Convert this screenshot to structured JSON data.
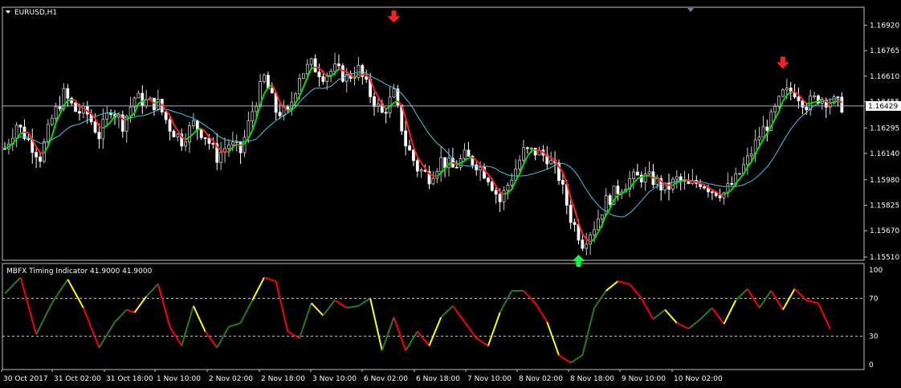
{
  "window": {
    "symbol_label": "EURUSD,H1"
  },
  "colors": {
    "background": "#000000",
    "frame": "#c0c0c0",
    "bull_candle": "#c8c8c8",
    "bear_candle": "#ffffff",
    "fast_up": "#00e000",
    "fast_down": "#ff2020",
    "slow_ma": "#40c8e0",
    "signal_down_arrow": "#ff2020",
    "signal_up_arrow": "#00ff40",
    "osc_red": "#ff0000",
    "osc_green": "#208020",
    "osc_yellow": "#ffff00",
    "level_line": "#c8c8c8",
    "text": "#ffffff"
  },
  "chart_data": [
    {
      "type": "line",
      "subtype": "candlestick",
      "title": "EURUSD,H1",
      "ylim": [
        1.1551,
        1.17
      ],
      "y_ticks": [
        "1.16920",
        "1.16765",
        "1.16610",
        "1.16455",
        "1.16295",
        "1.16140",
        "1.15980",
        "1.15825",
        "1.15670",
        "1.15510"
      ],
      "current_price": "1.16429",
      "x_ticks": [
        "30 Oct 2017",
        "31 Oct 02:00",
        "31 Oct 18:00",
        "1 Nov 10:00",
        "2 Nov 02:00",
        "2 Nov 18:00",
        "3 Nov 10:00",
        "6 Nov 02:00",
        "6 Nov 18:00",
        "7 Nov 10:00",
        "8 Nov 02:00",
        "8 Nov 18:00",
        "9 Nov 10:00",
        "10 Nov 02:00"
      ],
      "price_path": [
        [
          0,
          1.1617
        ],
        [
          3,
          1.1632
        ],
        [
          6,
          1.1622
        ],
        [
          9,
          1.1612
        ],
        [
          12,
          1.1635
        ],
        [
          15,
          1.165
        ],
        [
          18,
          1.164
        ],
        [
          21,
          1.1638
        ],
        [
          24,
          1.1625
        ],
        [
          27,
          1.1642
        ],
        [
          30,
          1.1632
        ],
        [
          33,
          1.1648
        ],
        [
          36,
          1.1645
        ],
        [
          39,
          1.1644
        ],
        [
          42,
          1.163
        ],
        [
          45,
          1.1622
        ],
        [
          48,
          1.1632
        ],
        [
          51,
          1.1625
        ],
        [
          54,
          1.1612
        ],
        [
          57,
          1.162
        ],
        [
          60,
          1.1615
        ],
        [
          63,
          1.164
        ],
        [
          66,
          1.166
        ],
        [
          69,
          1.164
        ],
        [
          72,
          1.1638
        ],
        [
          75,
          1.1662
        ],
        [
          78,
          1.1668
        ],
        [
          81,
          1.1662
        ],
        [
          84,
          1.1665
        ],
        [
          87,
          1.166
        ],
        [
          90,
          1.1665
        ],
        [
          93,
          1.165
        ],
        [
          96,
          1.1638
        ],
        [
          99,
          1.165
        ],
        [
          102,
          1.162
        ],
        [
          105,
          1.1605
        ],
        [
          108,
          1.16
        ],
        [
          111,
          1.161
        ],
        [
          114,
          1.1605
        ],
        [
          117,
          1.1612
        ],
        [
          120,
          1.1608
        ],
        [
          123,
          1.16
        ],
        [
          126,
          1.1585
        ],
        [
          129,
          1.16
        ],
        [
          132,
          1.1615
        ],
        [
          135,
          1.1615
        ],
        [
          138,
          1.1612
        ],
        [
          141,
          1.16
        ],
        [
          144,
          1.1575
        ],
        [
          147,
          1.156
        ],
        [
          150,
          1.157
        ],
        [
          153,
          1.1585
        ],
        [
          156,
          1.1592
        ],
        [
          159,
          1.1598
        ],
        [
          162,
          1.16
        ],
        [
          165,
          1.1598
        ],
        [
          168,
          1.1592
        ],
        [
          171,
          1.1598
        ],
        [
          174,
          1.1594
        ],
        [
          177,
          1.1597
        ],
        [
          180,
          1.1592
        ],
        [
          183,
          1.159
        ],
        [
          186,
          1.1598
        ],
        [
          189,
          1.161
        ],
        [
          192,
          1.1625
        ],
        [
          195,
          1.1635
        ],
        [
          198,
          1.165
        ],
        [
          201,
          1.1652
        ],
        [
          204,
          1.1644
        ],
        [
          207,
          1.1648
        ],
        [
          210,
          1.1646
        ],
        [
          213,
          1.1643
        ]
      ],
      "signals": [
        {
          "direction": "down",
          "bar": 99,
          "price": 1.1695
        },
        {
          "direction": "up",
          "bar": 146,
          "price": 1.1551
        },
        {
          "direction": "down",
          "bar": 198,
          "price": 1.1667
        }
      ]
    },
    {
      "type": "line",
      "title": "MBFX Timing Indicator 41.9000 41.9000",
      "ylim": [
        0,
        100
      ],
      "y_ticks": [
        "100",
        "70",
        "30",
        "0"
      ],
      "levels": [
        70,
        30
      ],
      "values": [
        [
          0,
          75
        ],
        [
          4,
          92
        ],
        [
          8,
          32
        ],
        [
          12,
          65
        ],
        [
          16,
          90
        ],
        [
          20,
          60
        ],
        [
          24,
          18
        ],
        [
          28,
          45
        ],
        [
          31,
          58
        ],
        [
          33,
          55
        ],
        [
          36,
          72
        ],
        [
          39,
          85
        ],
        [
          42,
          40
        ],
        [
          45,
          20
        ],
        [
          48,
          62
        ],
        [
          51,
          35
        ],
        [
          54,
          18
        ],
        [
          57,
          40
        ],
        [
          60,
          44
        ],
        [
          63,
          68
        ],
        [
          66,
          92
        ],
        [
          69,
          88
        ],
        [
          72,
          35
        ],
        [
          75,
          28
        ],
        [
          78,
          65
        ],
        [
          81,
          52
        ],
        [
          84,
          68
        ],
        [
          87,
          60
        ],
        [
          90,
          62
        ],
        [
          93,
          70
        ],
        [
          96,
          15
        ],
        [
          99,
          50
        ],
        [
          102,
          15
        ],
        [
          105,
          35
        ],
        [
          108,
          20
        ],
        [
          111,
          50
        ],
        [
          114,
          62
        ],
        [
          117,
          45
        ],
        [
          120,
          28
        ],
        [
          123,
          20
        ],
        [
          126,
          55
        ],
        [
          129,
          78
        ],
        [
          132,
          78
        ],
        [
          135,
          65
        ],
        [
          138,
          45
        ],
        [
          141,
          10
        ],
        [
          144,
          2
        ],
        [
          147,
          10
        ],
        [
          150,
          60
        ],
        [
          153,
          78
        ],
        [
          156,
          88
        ],
        [
          159,
          85
        ],
        [
          162,
          70
        ],
        [
          165,
          48
        ],
        [
          168,
          58
        ],
        [
          171,
          44
        ],
        [
          174,
          38
        ],
        [
          177,
          48
        ],
        [
          180,
          60
        ],
        [
          183,
          43
        ],
        [
          186,
          68
        ],
        [
          189,
          80
        ],
        [
          192,
          60
        ],
        [
          195,
          78
        ],
        [
          198,
          58
        ],
        [
          201,
          80
        ],
        [
          204,
          68
        ],
        [
          207,
          65
        ],
        [
          210,
          38
        ]
      ]
    }
  ]
}
